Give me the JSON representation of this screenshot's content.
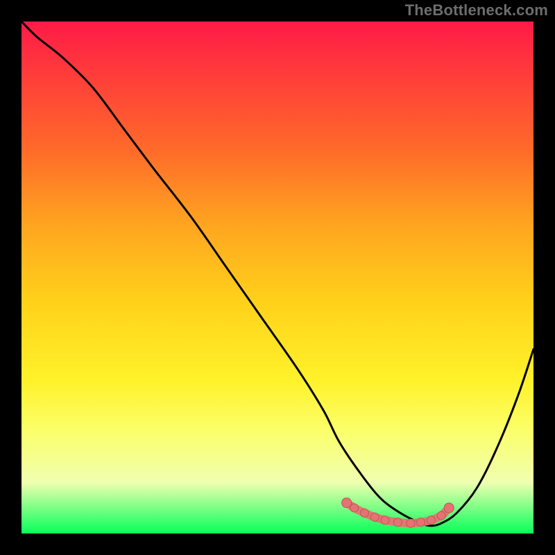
{
  "watermark": "TheBottleneck.com",
  "colors": {
    "page_bg": "#000000",
    "curve": "#000000",
    "marker_fill": "#E57373",
    "marker_stroke": "#C94F4F"
  },
  "chart_data": {
    "type": "line",
    "title": "",
    "xlabel": "",
    "ylabel": "",
    "xlim": [
      0,
      100
    ],
    "ylim": [
      0,
      100
    ],
    "grid": false,
    "legend": false,
    "series": [
      {
        "name": "bottleneck-curve",
        "x": [
          0,
          3,
          8,
          14,
          20,
          26,
          33,
          40,
          47,
          54,
          59,
          62,
          66,
          70,
          74,
          78,
          80,
          82,
          85,
          89,
          93,
          97,
          100
        ],
        "y": [
          100,
          97,
          93,
          87,
          79,
          71,
          62,
          52,
          42,
          32,
          24,
          18,
          12,
          7,
          4,
          2,
          1.5,
          2,
          4,
          9,
          17,
          27,
          36
        ]
      }
    ],
    "markers": {
      "name": "optimal-range",
      "color": "#E57373",
      "points": [
        {
          "x": 63.5,
          "y": 6.0
        },
        {
          "x": 65.0,
          "y": 5.0
        },
        {
          "x": 67.0,
          "y": 4.0
        },
        {
          "x": 69.0,
          "y": 3.2
        },
        {
          "x": 71.0,
          "y": 2.6
        },
        {
          "x": 73.5,
          "y": 2.2
        },
        {
          "x": 76.0,
          "y": 2.0
        },
        {
          "x": 78.0,
          "y": 2.2
        },
        {
          "x": 80.0,
          "y": 2.6
        },
        {
          "x": 82.0,
          "y": 3.5
        },
        {
          "x": 83.5,
          "y": 5.0
        }
      ]
    }
  }
}
